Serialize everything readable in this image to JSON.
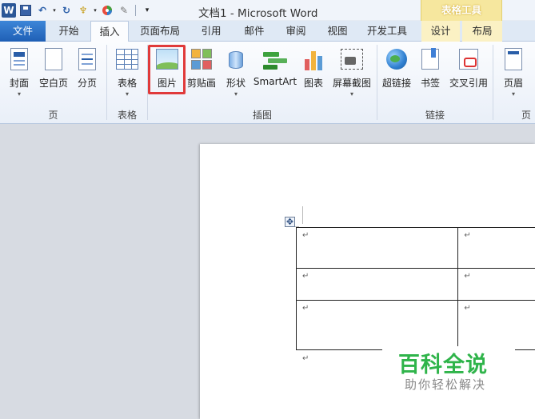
{
  "window": {
    "title": "文档1 - Microsoft Word",
    "contextual_header": "表格工具",
    "app_icon": "W"
  },
  "quick_access": {
    "icons": [
      "word-logo-icon",
      "save-icon",
      "undo-icon",
      "redo-icon",
      "format-painter-icon",
      "color-icon",
      "eraser-icon",
      "customize-icon"
    ]
  },
  "tabs": [
    {
      "label": "文件"
    },
    {
      "label": "开始"
    },
    {
      "label": "插入"
    },
    {
      "label": "页面布局"
    },
    {
      "label": "引用"
    },
    {
      "label": "邮件"
    },
    {
      "label": "审阅"
    },
    {
      "label": "视图"
    },
    {
      "label": "开发工具"
    },
    {
      "label": "设计"
    },
    {
      "label": "布局"
    }
  ],
  "active_tab": "插入",
  "ribbon": {
    "buttons": [
      {
        "label": "封面",
        "dropdown": "▾"
      },
      {
        "label": "空白页"
      },
      {
        "label": "分页"
      },
      {
        "label": "表格",
        "dropdown": "▾"
      },
      {
        "label": "图片"
      },
      {
        "label": "剪贴画"
      },
      {
        "label": "形状",
        "dropdown": "▾"
      },
      {
        "label": "SmartArt"
      },
      {
        "label": "图表"
      },
      {
        "label": "屏幕截图",
        "dropdown": "▾"
      },
      {
        "label": "超链接"
      },
      {
        "label": "书签"
      },
      {
        "label": "交叉引用"
      },
      {
        "label": "页眉",
        "dropdown": "▾"
      }
    ],
    "groups": [
      {
        "label": "页"
      },
      {
        "label": "表格"
      },
      {
        "label": "插图"
      },
      {
        "label": "链接"
      },
      {
        "label": "页"
      }
    ],
    "highlighted_button": "图片",
    "highlight_color": "#e03a3a"
  },
  "document": {
    "paragraph_mark": "↵",
    "table": {
      "rows": [
        [
          "↵",
          "↵"
        ],
        [
          "↵",
          "↵"
        ],
        [
          "↵",
          "↵"
        ]
      ]
    },
    "move_handle": "✥"
  },
  "watermark": {
    "title": "百科全说",
    "subtitle": "助你轻松解决",
    "color": "#2fb44a"
  }
}
